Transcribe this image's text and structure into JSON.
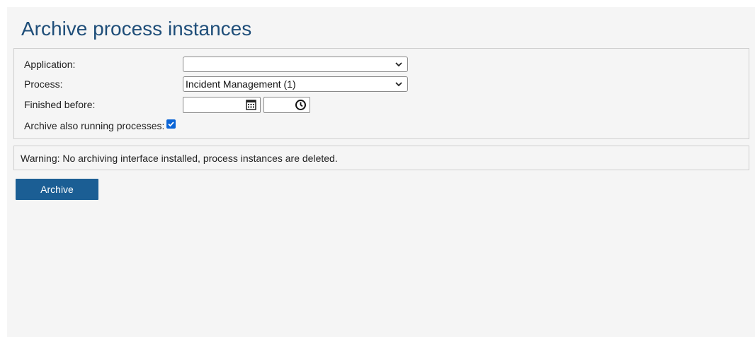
{
  "title": "Archive process instances",
  "form": {
    "application": {
      "label": "Application:",
      "value": ""
    },
    "process": {
      "label": "Process:",
      "value": "Incident Management (1)"
    },
    "finished_before": {
      "label": "Finished before:",
      "date_value": "",
      "time_value": ""
    },
    "archive_running": {
      "label": "Archive also running processes:",
      "checked": true
    }
  },
  "warning": "Warning: No archiving interface installed, process instances are deleted.",
  "actions": {
    "archive_label": "Archive"
  },
  "colors": {
    "title": "#1f4e79",
    "button": "#1b5e94",
    "checkbox": "#0a64d6",
    "background": "#f5f5f5"
  },
  "icons": [
    "chevron-down-icon",
    "calendar-icon",
    "clock-icon",
    "checkmark-icon"
  ]
}
